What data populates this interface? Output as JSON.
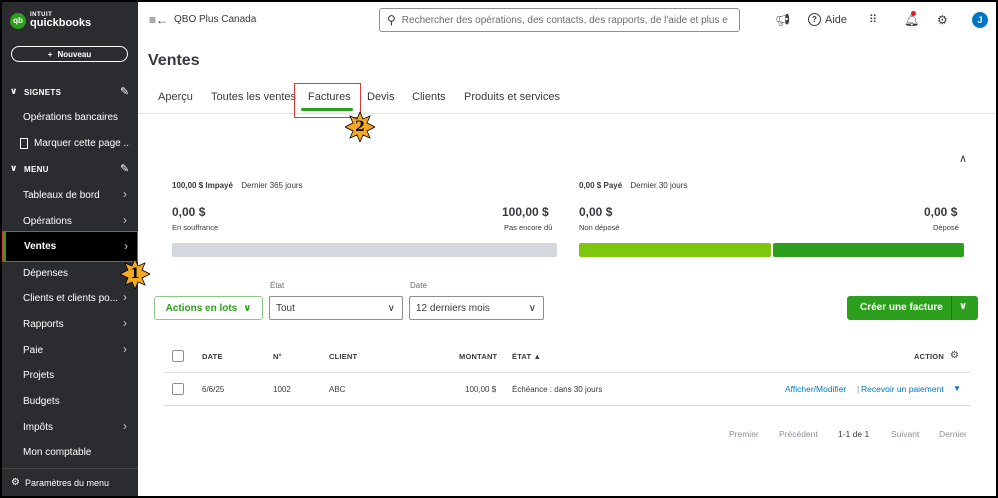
{
  "app": {
    "logo_brand": "INTUIT",
    "logo_name": "quickbooks",
    "logo_badge": "qb",
    "company": "QBO Plus Canada"
  },
  "sidebar": {
    "new_button": "Nouveau",
    "bookmarks_header": "SIGNETS",
    "bookmarks": [
      {
        "label": "Opérations bancaires"
      },
      {
        "label": "Marquer cette page ..."
      }
    ],
    "menu_header": "MENU",
    "menu": [
      {
        "label": "Tableaux de bord",
        "arrow": true
      },
      {
        "label": "Opérations",
        "arrow": true
      },
      {
        "label": "Ventes",
        "arrow": true,
        "active": true
      },
      {
        "label": "Dépenses",
        "arrow": false
      },
      {
        "label": "Clients et clients po...",
        "arrow": true
      },
      {
        "label": "Rapports",
        "arrow": true
      },
      {
        "label": "Paie",
        "arrow": true
      },
      {
        "label": "Projets",
        "arrow": false
      },
      {
        "label": "Budgets",
        "arrow": false
      },
      {
        "label": "Impôts",
        "arrow": true
      },
      {
        "label": "Mon comptable",
        "arrow": false
      }
    ],
    "footer": "Paramètres du menu"
  },
  "topbar": {
    "search_placeholder": "Rechercher des opérations, des contacts, des rapports, de l'aide et plus e",
    "help": "Aide",
    "avatar_initial": "J"
  },
  "page": {
    "title": "Ventes",
    "tabs": [
      "Aperçu",
      "Toutes les ventes",
      "Factures",
      "Devis",
      "Clients",
      "Produits et services"
    ],
    "active_tab": "Factures"
  },
  "money_bar": {
    "unpaid": {
      "amount": "100,00 $",
      "label": "Impayé",
      "period": "Dernier 365 jours",
      "overdue_amount": "0,00 $",
      "overdue_label": "En souffrance",
      "not_due_amount": "100,00 $",
      "not_due_label": "Pas encore dû"
    },
    "paid": {
      "amount": "0,00 $",
      "label": "Payé",
      "period": "Dernier 30 jours",
      "not_deposited_amount": "0,00 $",
      "not_deposited_label": "Non déposé",
      "deposited_amount": "0,00 $",
      "deposited_label": "Déposé"
    },
    "colors": {
      "unpaid_bar": "#d4d7dc",
      "not_deposited_bar": "#7fc60e",
      "deposited_bar": "#2ca01c"
    }
  },
  "filters": {
    "batch_actions": "Actions en lots",
    "status_label": "État",
    "status_value": "Tout",
    "date_label": "Date",
    "date_value": "12 derniers mois",
    "create_invoice": "Créer une facture"
  },
  "table": {
    "headers": {
      "date": "DATE",
      "no": "N°",
      "client": "CLIENT",
      "amount": "MONTANT",
      "status": "ÉTAT ▲",
      "action": "ACTION"
    },
    "rows": [
      {
        "date": "6/6/25",
        "no": "1002",
        "client": "ABC",
        "amount": "100,00 $",
        "status": "Échéance : dans 30 jours",
        "action_view": "Afficher/Modifier",
        "action_receive": "Recevoir un paiement"
      }
    ]
  },
  "pagination": {
    "first": "Premier",
    "prev": "Précédent",
    "range": "1-1 de 1",
    "next": "Suivant",
    "last": "Dernier"
  },
  "annotations": {
    "step1": "1",
    "step2": "2",
    "highlight_color": "#d93a3a",
    "badge_color": "#f7a823"
  },
  "colors": {
    "sidebar_bg": "#2b2c2f",
    "brand_green": "#2ca01c",
    "link_blue": "#0077c5"
  }
}
